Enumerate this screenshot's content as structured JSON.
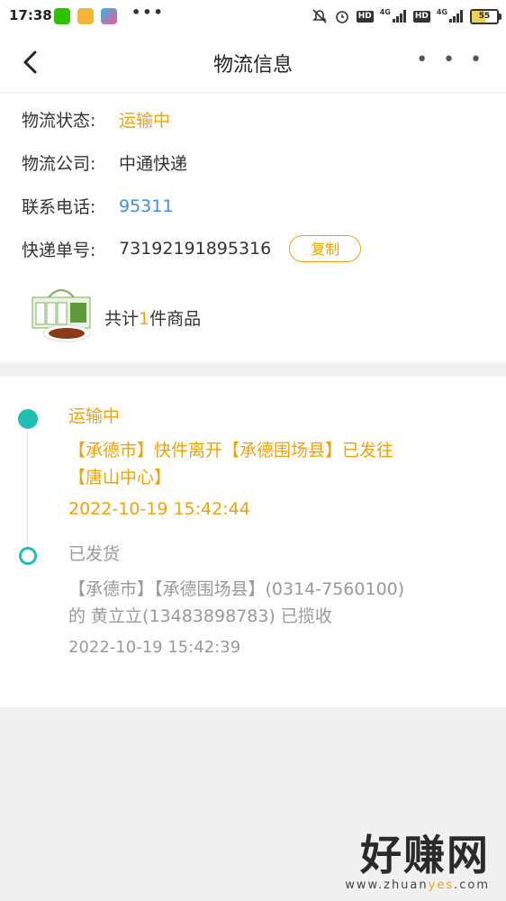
{
  "status_bar": {
    "time": "17:38",
    "dots": "•••",
    "hd1": "HD",
    "net1": "4G",
    "hd2": "HD",
    "net2": "4G",
    "battery": "55",
    "battery_level": 0.55,
    "apps": [
      "wechat-icon",
      "notes-icon",
      "video-icon"
    ],
    "status_icons": [
      "mute-icon",
      "alarm-icon",
      "signal-icon"
    ]
  },
  "header": {
    "title": "物流信息",
    "more": "• • •"
  },
  "info": {
    "status_label": "物流状态:",
    "status_value": "运输中",
    "company_label": "物流公司:",
    "company_value": "中通快递",
    "phone_label": "联系电话:",
    "phone_value": "95311",
    "tracking_label": "快递单号:",
    "tracking_value": "73192191895316",
    "copy_label": "复制",
    "count_prefix": "共计",
    "count_number": "1",
    "count_suffix": "件商品"
  },
  "timeline": [
    {
      "status": "运输中",
      "detail_line1": "【承德市】快件离开【承德围场县】已发往",
      "detail_line2": "【唐山中心】",
      "time": "2022-10-19 15:42:44"
    },
    {
      "status": "已发货",
      "detail_line1": "【承德市】【承德围场县】(0314-7560100)",
      "detail_line2": "的 黄立立(13483898783) 已揽收",
      "time": "2022-10-19 15:42:39"
    }
  ],
  "watermark": {
    "logo": "好赚网",
    "url_a": "www.zhuan",
    "url_b": "yes",
    "url_c": ".com"
  },
  "colors": {
    "accent": "#f1a10a",
    "teal": "#21bfb0",
    "link": "#3d8fe0"
  }
}
